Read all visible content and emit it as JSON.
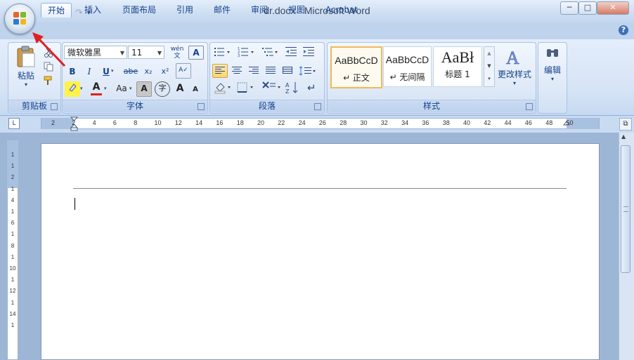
{
  "window": {
    "title": "dr.docx - Microsoft Word",
    "controls": {
      "minimize": "─",
      "maximize": "□",
      "close": "✕"
    }
  },
  "quick_access": {
    "save_icon": "save-icon",
    "undo_icon": "undo-icon",
    "redo_icon": "redo-icon",
    "customize": "▾"
  },
  "tabs": [
    {
      "label": "开始",
      "active": true
    },
    {
      "label": "插入"
    },
    {
      "label": "页面布局"
    },
    {
      "label": "引用"
    },
    {
      "label": "邮件"
    },
    {
      "label": "审阅"
    },
    {
      "label": "视图"
    },
    {
      "label": "Acrobat"
    }
  ],
  "help": "?",
  "clipboard": {
    "paste": "粘贴",
    "group_label": "剪贴板"
  },
  "font": {
    "family": "微软雅黑",
    "size": "11",
    "bold": "B",
    "italic": "I",
    "underline": "U",
    "strike": "abe",
    "subscript": "x₂",
    "superscript": "x²",
    "grow": "A",
    "shrink": "A",
    "change_case": "Aa",
    "font_color": "A",
    "group_label": "字体",
    "wen_icon": "wén",
    "char_border": "A",
    "enclose": "字",
    "shading": "A"
  },
  "paragraph": {
    "group_label": "段落"
  },
  "styles": {
    "items": [
      {
        "sample": "AaBbCcD",
        "name": "↵ 正文",
        "selected": true
      },
      {
        "sample": "AaBbCcD",
        "name": "↵ 无间隔"
      },
      {
        "sample": "AaBł",
        "name": "标题 1"
      }
    ],
    "change_styles": "更改样式",
    "group_label": "样式"
  },
  "editing": {
    "label": "编辑"
  },
  "ruler": {
    "selector": "L",
    "ticks": [
      "2",
      "2",
      "4",
      "6",
      "8",
      "10",
      "12",
      "14",
      "16",
      "18",
      "20",
      "22",
      "24",
      "26",
      "28",
      "30",
      "32",
      "34",
      "36",
      "38",
      "40",
      "42",
      "44",
      "46",
      "48",
      "50"
    ]
  },
  "vruler": {
    "ticks": [
      "1",
      "1",
      "2",
      "1",
      "4",
      "1",
      "6",
      "1",
      "8",
      "1",
      "10",
      "1",
      "12",
      "1",
      "14",
      "1"
    ]
  },
  "accent_colors": {
    "selected_style": "#efb95b",
    "ribbon_text": "#15428b",
    "annotation": "#e02020"
  }
}
